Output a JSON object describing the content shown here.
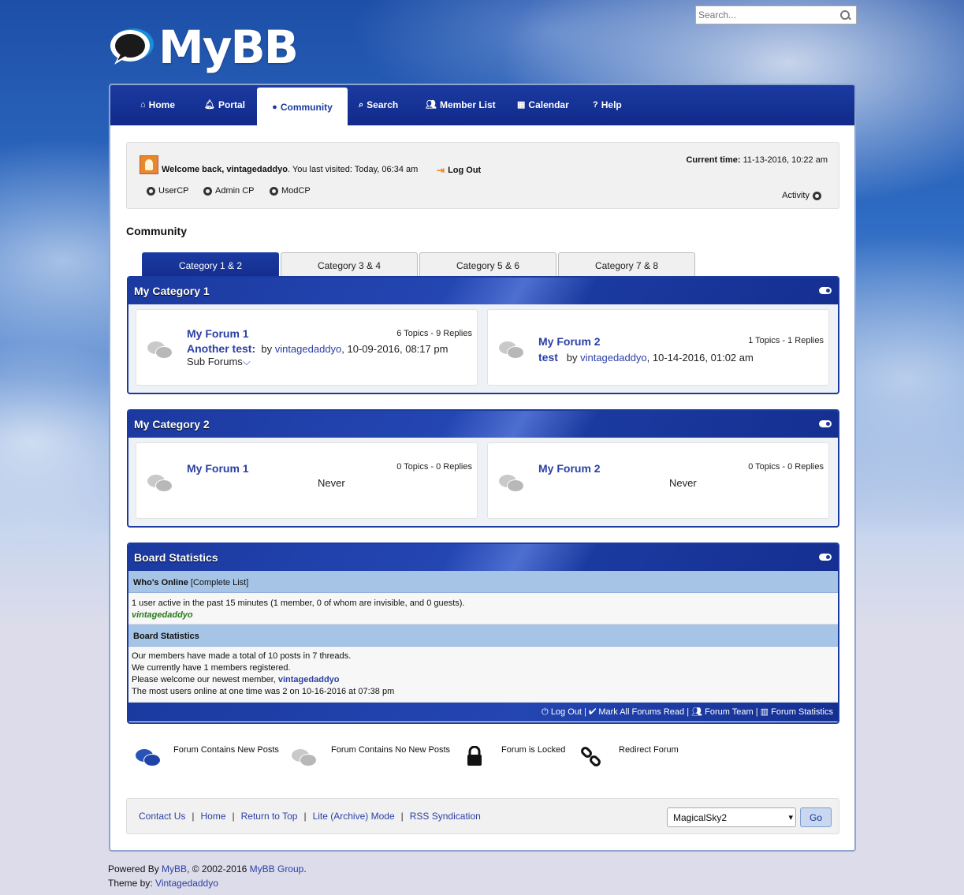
{
  "search": {
    "placeholder": "Search..."
  },
  "logo": {
    "text": "MyBB"
  },
  "nav": [
    {
      "label": "Home",
      "icon": "home-icon"
    },
    {
      "label": "Portal",
      "icon": "bell-icon"
    },
    {
      "label": "Community",
      "icon": "comments-icon"
    },
    {
      "label": "Search",
      "icon": "search-icon"
    },
    {
      "label": "Member List",
      "icon": "users-icon"
    },
    {
      "label": "Calendar",
      "icon": "calendar-icon"
    },
    {
      "label": "Help",
      "icon": "question-icon"
    }
  ],
  "welcome": {
    "greeting_prefix": "Welcome back, ",
    "username": "vintagedaddyo",
    "last_visited": ". You last visited: Today, 06:34 am",
    "logout": "Log Out",
    "current_time_label": "Current time:",
    "current_time": "11-13-2016, 10:22 am",
    "usercp": "UserCP",
    "admincp": "Admin CP",
    "modcp": "ModCP",
    "activity": "Activity"
  },
  "page_title": "Community",
  "tabs": [
    "Category 1 & 2",
    "Category 3 & 4",
    "Category 5 & 6",
    "Category 7 & 8"
  ],
  "categories": [
    {
      "title": "My Category 1",
      "forums": [
        {
          "name": "My Forum 1",
          "stats": "6 Topics - 9 Replies",
          "thread": "Another test:",
          "by": "by ",
          "author": "vintagedaddyo",
          "date": ", 10-09-2016, 08:17 pm",
          "sub": "Sub Forums"
        },
        {
          "name": "My Forum 2",
          "stats": "1 Topics - 1 Replies",
          "thread": "test",
          "by": "by ",
          "author": "vintagedaddyo",
          "date": ", 10-14-2016, 01:02 am"
        }
      ]
    },
    {
      "title": "My Category 2",
      "forums": [
        {
          "name": "My Forum 1",
          "stats": "0 Topics - 0 Replies",
          "last": "Never"
        },
        {
          "name": "My Forum 2",
          "stats": "0 Topics - 0 Replies",
          "last": "Never"
        }
      ]
    }
  ],
  "board_stats": {
    "title": "Board Statistics",
    "whos_online": "Who's Online",
    "complete_list": "[Complete List]",
    "online_line": "1 user active in the past 15 minutes (1 member, 0 of whom are invisible, and 0 guests).",
    "online_user": "vintagedaddyo",
    "stats_title": "Board Statistics",
    "line1": "Our members have made a total of 10 posts in 7 threads.",
    "line2": "We currently have 1 members registered.",
    "line3_prefix": "Please welcome our newest member, ",
    "newest_member": "vintagedaddyo",
    "line4": "The most users online at one time was 2 on 10-16-2016 at 07:38 pm",
    "footer": {
      "logout": "Log Out",
      "mark_read": "Mark All Forums Read",
      "team": "Forum Team",
      "stats": "Forum Statistics",
      "sep": "|"
    }
  },
  "legend": [
    {
      "label": "Forum Contains New Posts"
    },
    {
      "label": "Forum Contains No New Posts"
    },
    {
      "label": "Forum is Locked"
    },
    {
      "label": "Redirect Forum"
    }
  ],
  "footer": {
    "links": [
      "Contact Us",
      "Home",
      "Return to Top",
      "Lite (Archive) Mode",
      "RSS Syndication"
    ],
    "sep": "|",
    "theme": "MagicalSky2",
    "go": "Go"
  },
  "powered": {
    "prefix": "Powered By ",
    "mybb": "MyBB",
    "copy": ", © 2002-2016 ",
    "group": "MyBB Group",
    "dot": ".",
    "theme_by": "Theme by: ",
    "author": "Vintagedaddyo"
  },
  "colors": {
    "brand": "#1b3aa0",
    "link": "#2b3fa5",
    "online_user": "#2a7a1a"
  }
}
